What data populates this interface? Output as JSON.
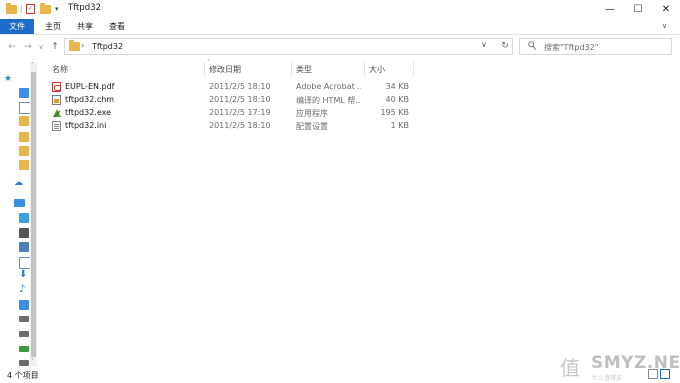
{
  "window": {
    "title": "Tftpd32",
    "controls": [
      "—",
      "☐",
      "✕"
    ]
  },
  "ribbon": {
    "tabs": [
      "文件",
      "主页",
      "共享",
      "查看"
    ]
  },
  "nav": {
    "back": "←",
    "forward": "→",
    "recent": "∨",
    "up": "↑"
  },
  "address": {
    "path": "Tftpd32",
    "separator": "›",
    "dropdown": "∨",
    "refresh": "↻"
  },
  "search": {
    "placeholder": "搜索\"Tftpd32\"",
    "icon": "search-icon"
  },
  "columns": {
    "name": "名称",
    "date": "修改日期",
    "type": "类型",
    "size": "大小"
  },
  "files": [
    {
      "name": "EUPL-EN.pdf",
      "date": "2011/2/5 18:10",
      "type": "Adobe Acrobat ...",
      "size": "34 KB",
      "icon": "pdf-icon"
    },
    {
      "name": "tftpd32.chm",
      "date": "2011/2/5 18:10",
      "type": "编译的 HTML 帮...",
      "size": "40 KB",
      "icon": "chm-icon"
    },
    {
      "name": "tftpd32.exe",
      "date": "2011/2/5 17:19",
      "type": "应用程序",
      "size": "195 KB",
      "icon": "exe-icon"
    },
    {
      "name": "tftpd32.ini",
      "date": "2011/2/5 18:10",
      "type": "配置设置",
      "size": "1 KB",
      "icon": "ini-icon"
    }
  ],
  "status": {
    "count": "4 个项目"
  },
  "watermark": {
    "text": "SMYZ.NET",
    "sub": "什么值得买"
  },
  "colors": {
    "accent": "#1e6cc7",
    "folder": "#e8b64a"
  }
}
